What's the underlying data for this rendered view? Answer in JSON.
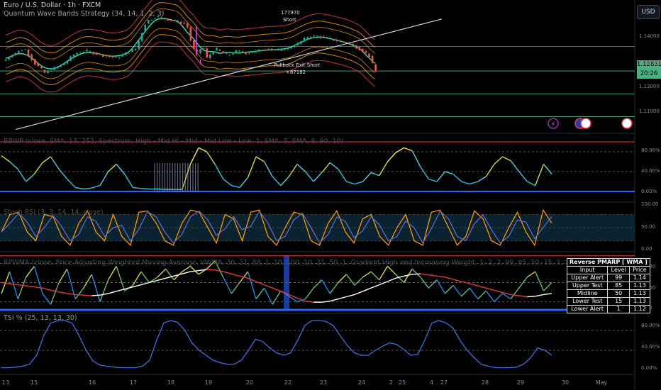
{
  "header": {
    "symbol": "Euro / U.S. Dollar · 1h · FXCM",
    "strategy": "Quantum Wave Bands Strategy (34, 14, 1, 2, 3)",
    "currency": "USD"
  },
  "price_badge": {
    "price": "1.12831",
    "countdown": "20:26"
  },
  "annotations": {
    "short_id": "177970",
    "short_label": "Short",
    "exit_label": "Pullback Exit Short",
    "exit_id": "+87182"
  },
  "pane_titles": {
    "bbwp": "BBWP (close, SMA, 13, 252, Spectrum, High - Mid Hi - Mid - Mid Low - Low, 1, SMA, 5, SMA, 8, 90, 10)",
    "stoch": "Stoch RSI (3, 3, 14, 14, close)",
    "rev": "RPWMA (close, Price Adjusting Weighted Moving Average, VWMA, 30, 21, 88, 1, 10, 100, 10, 21, 50, 1, Gradient High and Increasing Weight, 1, 2, 2, 99, 85, 50, 15, 1, 20, 0, 10, 0, 0, 1)",
    "tsi": "TSI % (25, 13, 13, 30)"
  },
  "price_axis_labels": [
    "1.14000",
    "1.13000",
    "1.12000",
    "1.11000"
  ],
  "pct_axis_labels": [
    "80.00%",
    "40.00%",
    "0.00%"
  ],
  "stoch_axis_labels": [
    "100.00",
    "50.00",
    "0.00"
  ],
  "rev_axis_labels": [
    "80.00",
    "40.00",
    "0.00"
  ],
  "date_axis": [
    "13",
    "15",
    "16",
    "17",
    "18",
    "19",
    "20",
    "22",
    "23",
    "24",
    "25",
    "27",
    "28",
    "29",
    "30",
    "May",
    "2",
    "4"
  ],
  "rev_table": {
    "headers": [
      "Reverse PMARP [ WMA ]",
      "Input",
      "Level",
      "Price"
    ],
    "rows": [
      [
        "Upper Alert",
        "99",
        "1.14"
      ],
      [
        "Upper Test",
        "85",
        "1.13"
      ],
      [
        "Midline",
        "50",
        "1.13"
      ],
      [
        "Lower Test",
        "15",
        "1.13"
      ],
      [
        "Lower Alert",
        "1",
        "1.12"
      ]
    ]
  },
  "colors": {
    "bull": "#26a69a",
    "bear": "#ef5350",
    "band_red": "#f23645",
    "band_orange": "#ff9800",
    "mid_green": "#2ee6a0",
    "blue": "#2962ff",
    "level_green": "#4caf80",
    "trend": "#d1d4dc",
    "badge": "#4caf80"
  },
  "chart_data": [
    {
      "type": "candlestick",
      "title": "Euro / U.S. Dollar · 1h · FXCM",
      "ylim": [
        1.105,
        1.157
      ],
      "x_range": [
        "Apr 13",
        "May 4"
      ],
      "close_path": [
        [
          13,
          1.134
        ],
        [
          13.5,
          1.137
        ],
        [
          14,
          1.139
        ],
        [
          14.5,
          1.133
        ],
        [
          15,
          1.129
        ],
        [
          15.5,
          1.131
        ],
        [
          16,
          1.133
        ],
        [
          16.5,
          1.137
        ],
        [
          17,
          1.138
        ],
        [
          17.5,
          1.137
        ],
        [
          18,
          1.136
        ],
        [
          18.5,
          1.135
        ],
        [
          19,
          1.137
        ],
        [
          19.5,
          1.139
        ],
        [
          20,
          1.15
        ],
        [
          20.5,
          1.152
        ],
        [
          21,
          1.151
        ],
        [
          21.5,
          1.15
        ],
        [
          22,
          1.149
        ],
        [
          22.3,
          1.139
        ],
        [
          22.5,
          1.137
        ],
        [
          22.8,
          1.14
        ],
        [
          23,
          1.135
        ],
        [
          23.4,
          1.139
        ],
        [
          24,
          1.136
        ],
        [
          24.5,
          1.138
        ],
        [
          25,
          1.137
        ],
        [
          26,
          1.139
        ],
        [
          26.5,
          1.138
        ],
        [
          27,
          1.139
        ],
        [
          27.5,
          1.141
        ],
        [
          28,
          1.144
        ],
        [
          28.5,
          1.144
        ],
        [
          29,
          1.143
        ],
        [
          29.5,
          1.142
        ],
        [
          30,
          1.141
        ],
        [
          30.5,
          1.139
        ],
        [
          31,
          1.136
        ],
        [
          31.3,
          1.1295
        ]
      ],
      "horizontal_levels": [
        1.1298,
        1.1205,
        1.1112,
        1.1398
      ],
      "trendline": [
        [
          13.5,
          1.106
        ],
        [
          34.5,
          1.151
        ]
      ]
    },
    {
      "type": "line",
      "title": "BBWP",
      "ylim": [
        0,
        100
      ],
      "series": [
        {
          "values": [
            72,
            60,
            45,
            20,
            35,
            58,
            70,
            45,
            25,
            8,
            5,
            7,
            12,
            40,
            55,
            35,
            8,
            6,
            5,
            5,
            4,
            4,
            4,
            55,
            88,
            80,
            55,
            25,
            12,
            8,
            28,
            70,
            60,
            30,
            12,
            30,
            55,
            40,
            20,
            38,
            58,
            45,
            20,
            15,
            20,
            38,
            32,
            60,
            78,
            88,
            82,
            50,
            25,
            20,
            40,
            35,
            20,
            15,
            20,
            30,
            55,
            70,
            62,
            40,
            20,
            12,
            55,
            35
          ]
        }
      ]
    },
    {
      "type": "line",
      "title": "Stoch RSI",
      "ylim": [
        0,
        100
      ],
      "series": [
        {
          "values": [
            40,
            80,
            85,
            40,
            20,
            80,
            75,
            30,
            10,
            60,
            88,
            40,
            20,
            80,
            30,
            10,
            85,
            88,
            60,
            20,
            10,
            60,
            90,
            85,
            50,
            15,
            80,
            70,
            20,
            85,
            90,
            30,
            10,
            50,
            85,
            80,
            20,
            10,
            60,
            88,
            40,
            15,
            70,
            80,
            30,
            10,
            50,
            80,
            20,
            10,
            85,
            90,
            50,
            10,
            30,
            88,
            70,
            20,
            10,
            50,
            85,
            40,
            10,
            90,
            60
          ]
        }
      ]
    },
    {
      "type": "line",
      "title": "RPWMA",
      "ylim": [
        0,
        100
      ],
      "series": [
        {
          "values": [
            50,
            48,
            46,
            44,
            42,
            40,
            36,
            33,
            30,
            28,
            27,
            26,
            27,
            30,
            34,
            38,
            42,
            46,
            50,
            54,
            58,
            62,
            66,
            70,
            72,
            74,
            73,
            70,
            66,
            62,
            58,
            52,
            46,
            40,
            34,
            28,
            22,
            16,
            14,
            14,
            16,
            20,
            24,
            28,
            34,
            40,
            46,
            52,
            58,
            62,
            65,
            66,
            64,
            62,
            60,
            56,
            52,
            48,
            44,
            40,
            36,
            32,
            28,
            26,
            24,
            25,
            28,
            30
          ]
        },
        {
          "values": [
            30,
            70,
            20,
            60,
            80,
            30,
            10,
            50,
            75,
            20,
            40,
            65,
            15,
            55,
            80,
            35,
            45,
            70,
            50,
            60,
            75,
            55,
            70,
            80,
            65,
            75,
            90,
            60,
            30,
            50,
            70,
            20,
            40,
            10,
            35,
            25,
            15,
            20,
            40,
            55,
            30,
            50,
            65,
            45,
            60,
            70,
            55,
            80,
            65,
            50,
            75,
            60,
            40,
            55,
            30,
            45,
            25,
            40,
            20,
            35,
            15,
            30,
            20,
            40,
            60,
            70,
            35,
            50
          ]
        }
      ]
    },
    {
      "type": "line",
      "title": "TSI %",
      "ylim": [
        0,
        100
      ],
      "series": [
        {
          "values": [
            5,
            5,
            6,
            8,
            12,
            30,
            70,
            95,
            100,
            100,
            95,
            70,
            40,
            18,
            10,
            8,
            6,
            5,
            5,
            5,
            8,
            20,
            60,
            95,
            100,
            96,
            80,
            55,
            40,
            30,
            20,
            15,
            12,
            12,
            20,
            40,
            62,
            58,
            45,
            35,
            30,
            35,
            60,
            90,
            100,
            100,
            98,
            90,
            70,
            50,
            35,
            30,
            30,
            40,
            48,
            55,
            52,
            42,
            30,
            32,
            60,
            95,
            100,
            95,
            85,
            60,
            40,
            25,
            12,
            8,
            5,
            5,
            5,
            6,
            12,
            25,
            45,
            40,
            30
          ]
        }
      ]
    }
  ]
}
